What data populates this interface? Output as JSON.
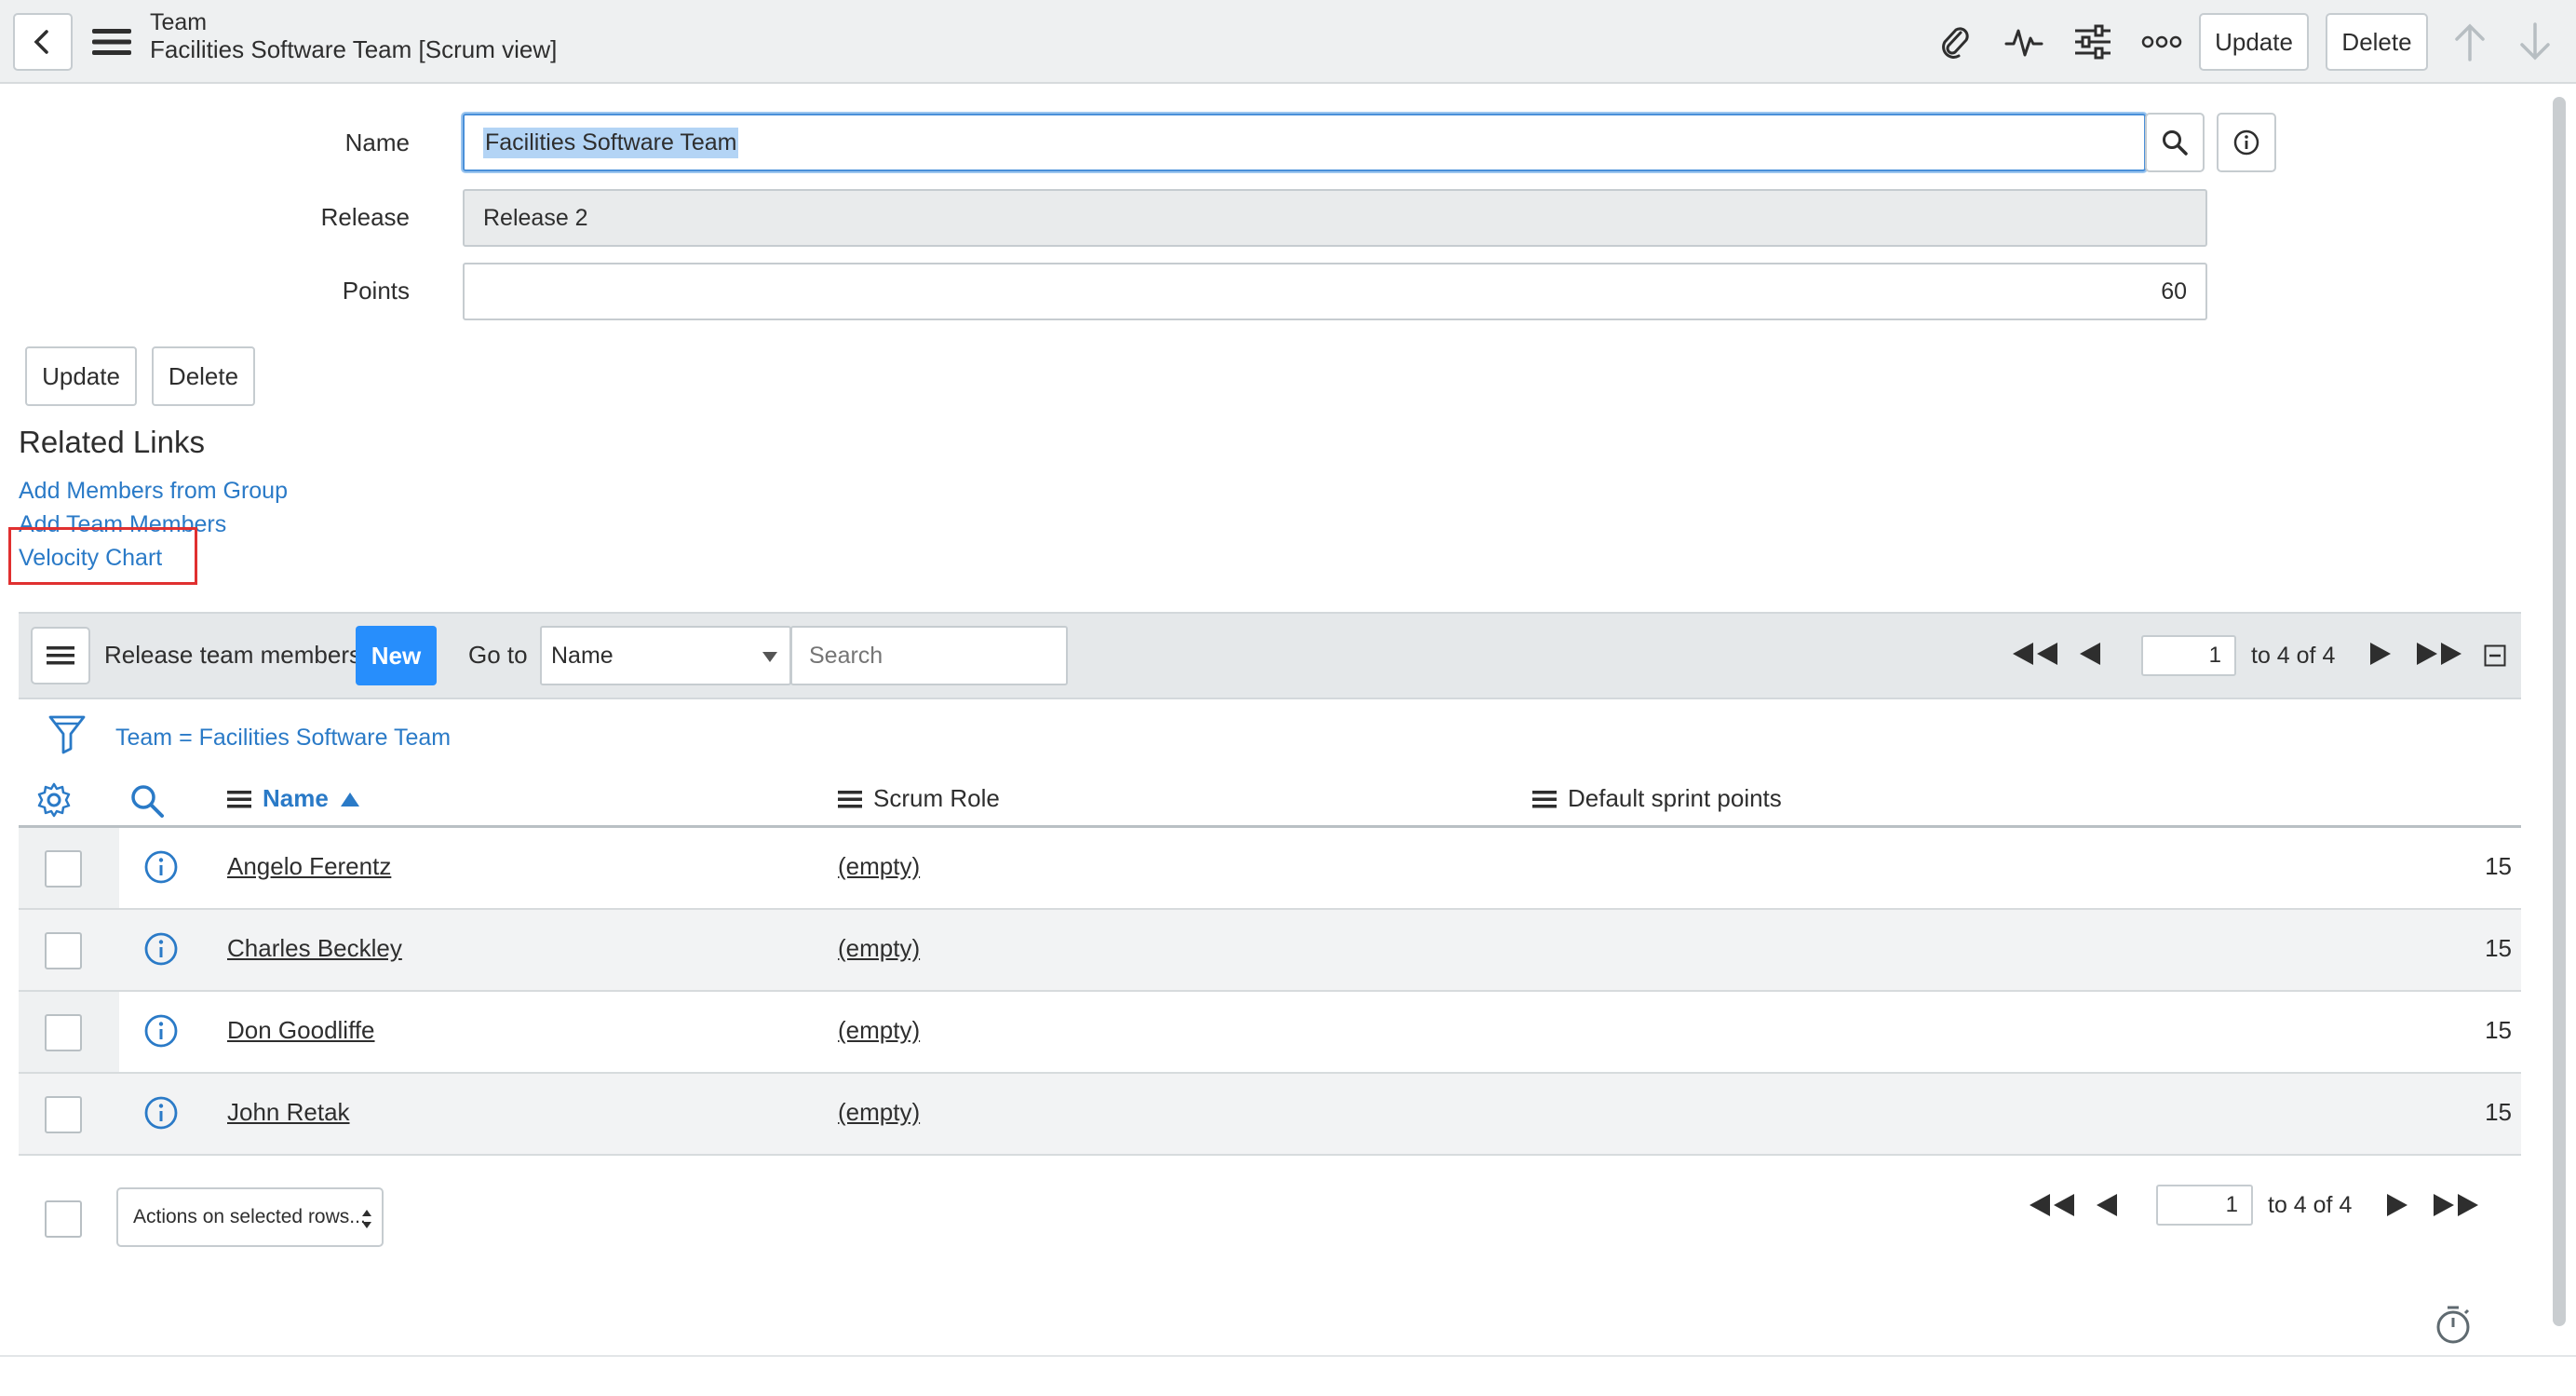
{
  "header": {
    "title": "Team",
    "subtitle": "Facilities Software Team [Scrum view]",
    "update_label": "Update",
    "delete_label": "Delete"
  },
  "form": {
    "name_label": "Name",
    "name_value": "Facilities Software Team",
    "release_label": "Release",
    "release_value": "Release 2",
    "points_label": "Points",
    "points_value": "60",
    "update_label": "Update",
    "delete_label": "Delete"
  },
  "related_links": {
    "title": "Related Links",
    "links": [
      "Add Members from Group",
      "Add Team Members",
      "Velocity Chart"
    ]
  },
  "list": {
    "title": "Release team members",
    "new_label": "New",
    "goto_label": "Go to",
    "goto_field": "Name",
    "search_placeholder": "Search",
    "page_value": "1",
    "page_text": "to 4 of 4",
    "filter_text": "Team = Facilities Software Team",
    "columns": {
      "name": "Name",
      "scrum_role": "Scrum Role",
      "default_sprint_points": "Default sprint points"
    },
    "rows": [
      {
        "name": "Angelo Ferentz",
        "role": "(empty)",
        "points": "15"
      },
      {
        "name": "Charles Beckley",
        "role": "(empty)",
        "points": "15"
      },
      {
        "name": "Don Goodliffe",
        "role": "(empty)",
        "points": "15"
      },
      {
        "name": "John Retak",
        "role": "(empty)",
        "points": "15"
      }
    ],
    "actions_label": "Actions on selected rows...",
    "bottom_page_value": "1",
    "bottom_page_text": "to 4 of 4"
  },
  "colors": {
    "accent": "#2a7ac7",
    "new_button": "#278efc",
    "highlight_box": "#e03030"
  },
  "icons": [
    "back-icon",
    "menu-icon",
    "paperclip-icon",
    "activity-icon",
    "sliders-icon",
    "more-icon",
    "arrow-up-icon",
    "arrow-down-icon",
    "search-icon",
    "info-icon",
    "filter-icon",
    "gear-icon",
    "sort-asc-icon",
    "first-page-icon",
    "prev-page-icon",
    "next-page-icon",
    "last-page-icon",
    "collapse-icon",
    "timer-icon"
  ]
}
